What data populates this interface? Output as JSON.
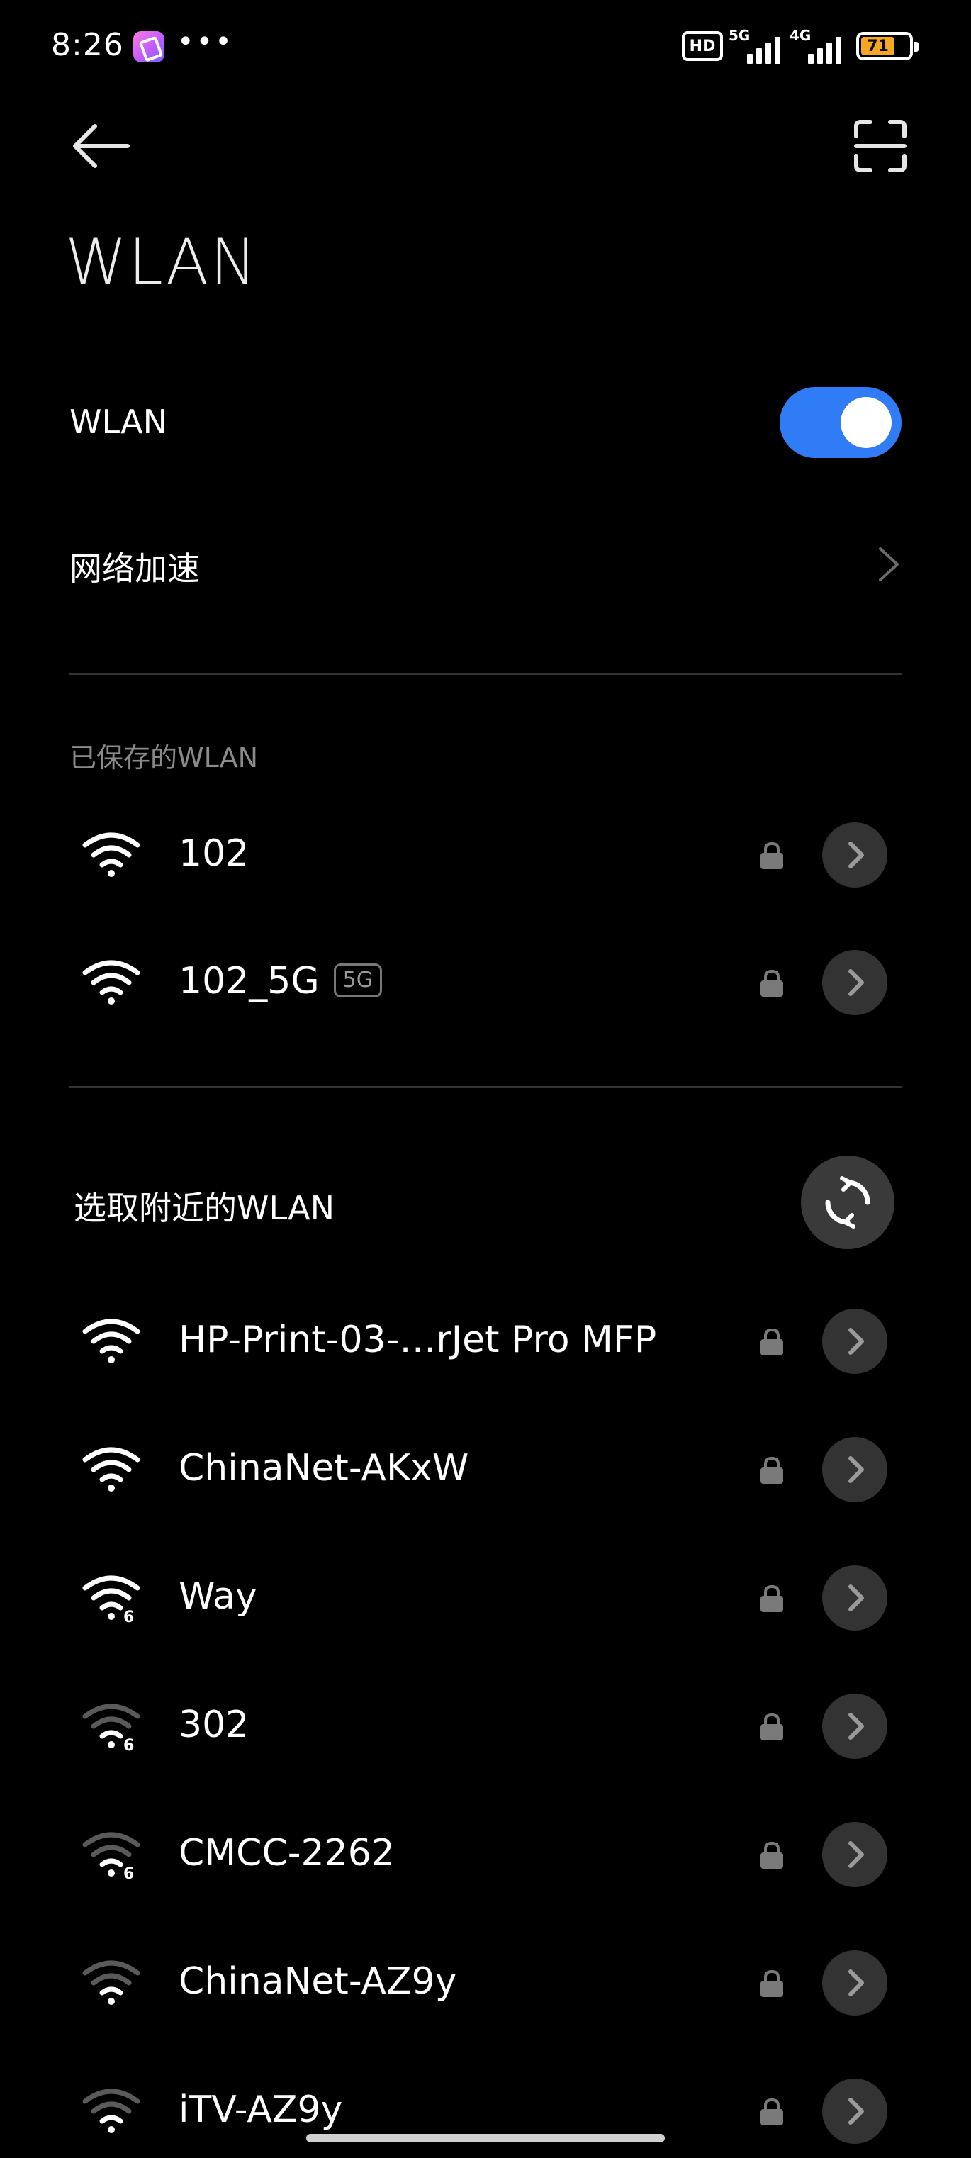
{
  "status_bar": {
    "time": "8:26",
    "dots": "•••",
    "hd": "HD",
    "signal1": "5G",
    "signal2": "4G",
    "battery": "71",
    "battery_level_percent": 71,
    "battery_color": "#f5a623"
  },
  "header": {
    "title": "WLAN",
    "back_icon": "arrow-left-icon",
    "scan_icon": "qr-scan-icon"
  },
  "wlan_toggle": {
    "label": "WLAN",
    "on": true,
    "accent": "#2f7cf6"
  },
  "network_boost": {
    "label": "网络加速"
  },
  "saved_section": {
    "label": "已保存的WLAN",
    "networks": [
      {
        "name": "102",
        "badge": "",
        "signal": "full"
      },
      {
        "name": "102_5G",
        "badge": "5G",
        "signal": "full"
      }
    ]
  },
  "nearby_section": {
    "label": "选取附近的WLAN",
    "refresh_icon": "refresh-icon",
    "networks": [
      {
        "name": "HP-Print-03-…rJet Pro MFP",
        "signal": "full",
        "wifi6": false
      },
      {
        "name": "ChinaNet-AKxW",
        "signal": "full",
        "wifi6": false
      },
      {
        "name": "Way",
        "signal": "full",
        "wifi6": true
      },
      {
        "name": "302",
        "signal": "weak",
        "wifi6": true
      },
      {
        "name": "CMCC-2262",
        "signal": "weak",
        "wifi6": true
      },
      {
        "name": "ChinaNet-AZ9y",
        "signal": "weak",
        "wifi6": false
      },
      {
        "name": "iTV-AZ9y",
        "signal": "weak",
        "wifi6": false
      }
    ]
  }
}
